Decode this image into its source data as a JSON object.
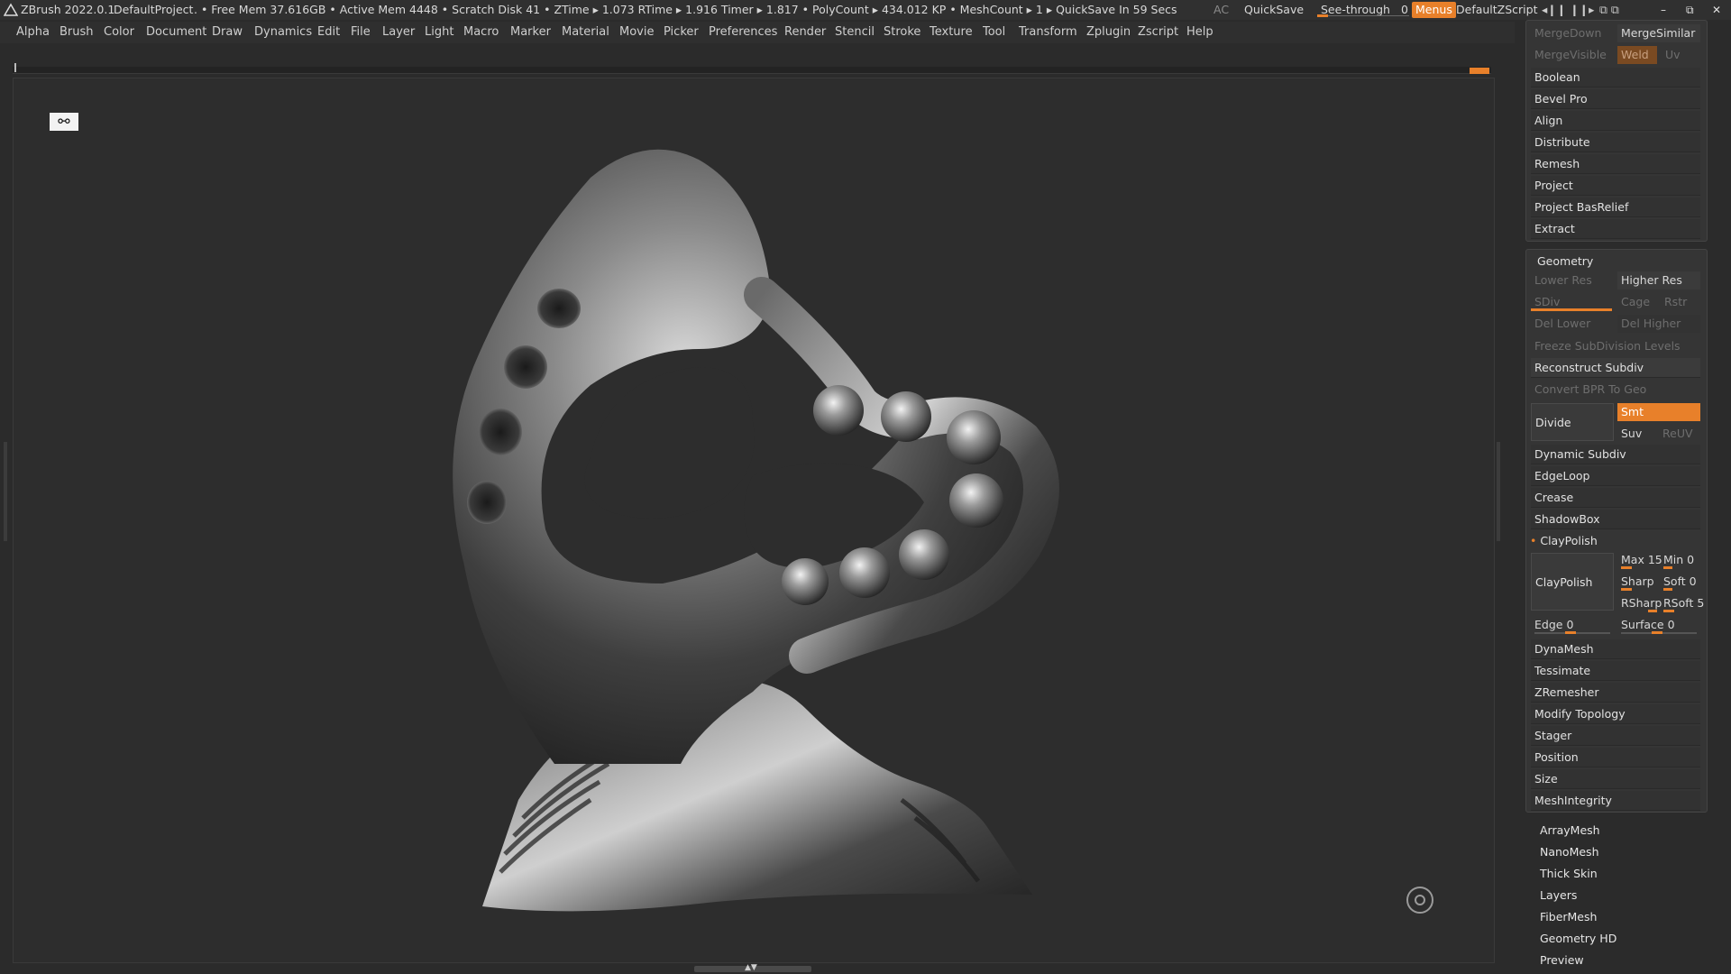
{
  "titlebar": {
    "app": "ZBrush 2022.0.1",
    "project": "DefaultProject",
    "stats": ". • Free Mem 37.616GB • Active Mem 4448 • Scratch Disk 41 •  ZTime ▸ 1.073 RTime ▸ 1.916 Timer ▸ 1.817 • PolyCount ▸ 434.012 KP  • MeshCount ▸ 1   ▸ QuickSave In 59 Secs",
    "ac": "AC",
    "quicksave": "QuickSave",
    "see_through_label": "See-through",
    "see_through_value": "0",
    "menus": "Menus",
    "zscript": "DefaultZScript",
    "minimize": "–",
    "restore": "⧉",
    "close": "✕"
  },
  "menubar": {
    "items": [
      "Alpha",
      "Brush",
      "Color",
      "Document",
      "Draw",
      "Dynamics",
      "Edit",
      "File",
      "Layer",
      "Light",
      "Macro",
      "Marker",
      "Material",
      "Movie",
      "Picker",
      "Preferences",
      "Render",
      "Stencil",
      "Stroke",
      "Texture",
      "Tool",
      "Transform",
      "Zplugin",
      "Zscript",
      "Help"
    ]
  },
  "canvas": {
    "perspective_icon": "⚯"
  },
  "panel_top": {
    "merge_down": "MergeDown",
    "merge_similar": "MergeSimilar",
    "merge_visible": "MergeVisible",
    "weld": "Weld",
    "uv": "Uv",
    "items": [
      "Boolean",
      "Bevel Pro",
      "Align",
      "Distribute",
      "Remesh",
      "Project",
      "Project BasRelief",
      "Extract"
    ]
  },
  "geometry": {
    "title": "Geometry",
    "lower_res": "Lower Res",
    "higher_res": "Higher Res",
    "sdiv": "SDiv",
    "cage": "Cage",
    "rstr": "Rstr",
    "del_lower": "Del Lower",
    "del_higher": "Del Higher",
    "freeze": "Freeze SubDivision Levels",
    "reconstruct": "Reconstruct Subdiv",
    "convert_bpr": "Convert BPR To Geo",
    "divide": "Divide",
    "smt": "Smt",
    "suv": "Suv",
    "reuv": "ReUV",
    "items_a": [
      "Dynamic Subdiv",
      "EdgeLoop",
      "Crease",
      "ShadowBox"
    ],
    "claypolish_header": "ClayPolish",
    "claypolish_btn": "ClayPolish",
    "max_label": "Max",
    "max_value": "15",
    "min_label": "Min",
    "min_value": "0",
    "sharp_label": "Sharp",
    "soft_label": "Soft",
    "soft_value": "0",
    "rsharp_label": "RSharp",
    "rsoft_label": "RSoft",
    "rsoft_value": "5",
    "edge_label": "Edge",
    "edge_value": "0",
    "surface_label": "Surface",
    "surface_value": "0",
    "items_b": [
      "DynaMesh",
      "Tessimate",
      "ZRemesher",
      "Modify Topology",
      "Stager",
      "Position",
      "Size",
      "MeshIntegrity"
    ]
  },
  "subpalettes": {
    "items": [
      "ArrayMesh",
      "NanoMesh",
      "Thick Skin",
      "Layers",
      "FiberMesh",
      "Geometry HD",
      "Preview"
    ]
  },
  "colors": {
    "accent": "#e8802a",
    "background": "#2b2b2b"
  }
}
